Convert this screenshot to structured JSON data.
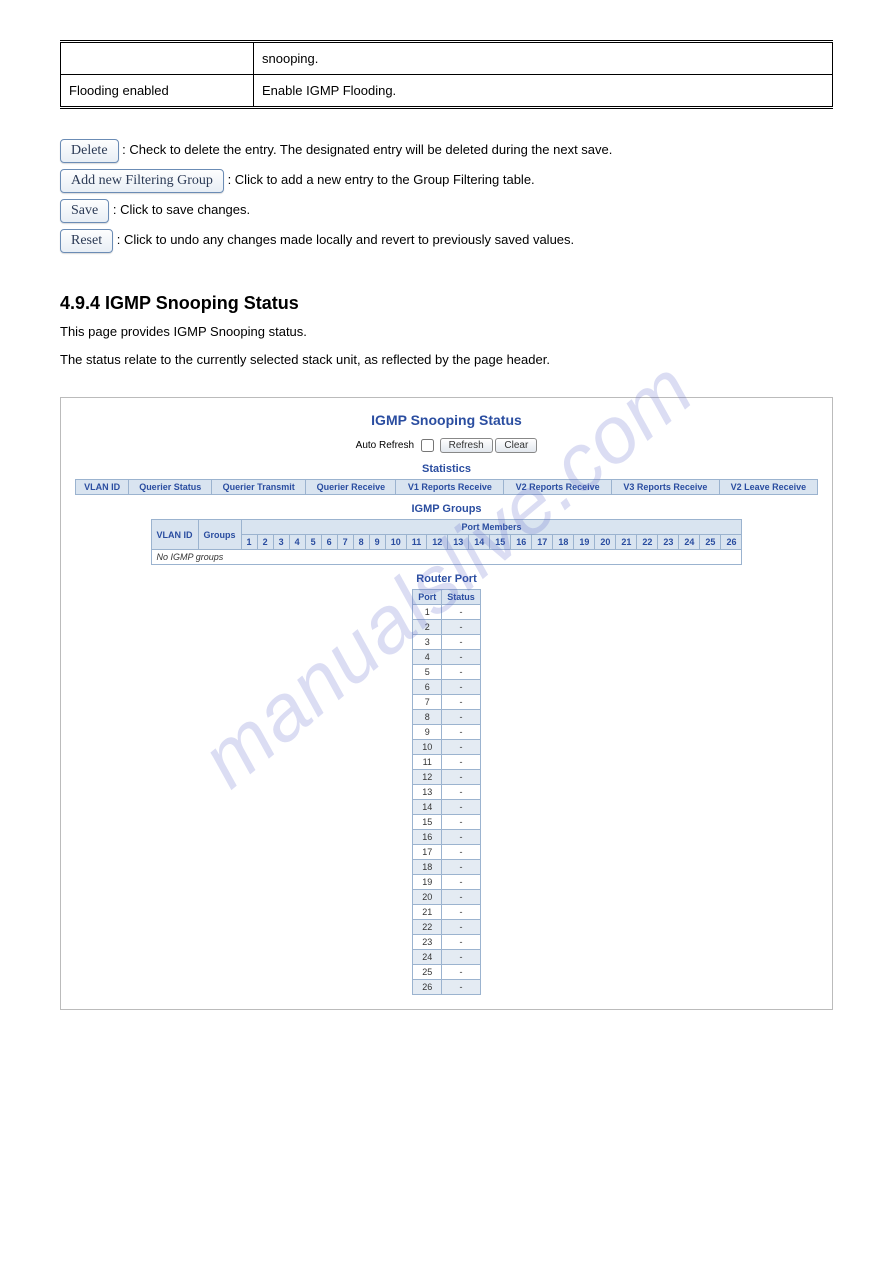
{
  "doc_table": {
    "row1_col1": "",
    "row1_col2": "snooping.",
    "row2_col1": "Flooding enabled",
    "row2_col2": "Enable IGMP Flooding."
  },
  "buttons": {
    "delete": "Delete",
    "delete_desc": ": Check to delete the entry. The designated entry will be deleted during the next save.",
    "add": "Add new Filtering Group",
    "add_desc": ": Click to add a new entry to the Group Filtering table.",
    "save": "Save",
    "save_desc": ": Click to save changes.",
    "reset": "Reset",
    "reset_desc": ": Click to undo any changes made locally and revert to previously saved values."
  },
  "heading": "4.9.4 IGMP Snooping Status",
  "body": "This page provides IGMP Snooping status.",
  "body2": "The status relate to the currently selected stack unit, as reflected by the page header.",
  "watermark": "manualslive.com",
  "screenshot": {
    "title": "IGMP Snooping Status",
    "auto_label": "Auto Refresh",
    "refresh": "Refresh",
    "clear": "Clear",
    "sub_stats": "Statistics",
    "stats_headers": [
      "VLAN ID",
      "Querier Status",
      "Querier Transmit",
      "Querier Receive",
      "V1 Reports Receive",
      "V2 Reports Receive",
      "V3 Reports Receive",
      "V2 Leave Receive"
    ],
    "sub_groups": "IGMP Groups",
    "groups_span": "Port Members",
    "groups_h1": "VLAN ID",
    "groups_h2": "Groups",
    "port_nums": [
      "1",
      "2",
      "3",
      "4",
      "5",
      "6",
      "7",
      "8",
      "9",
      "10",
      "11",
      "12",
      "13",
      "14",
      "15",
      "16",
      "17",
      "18",
      "19",
      "20",
      "21",
      "22",
      "23",
      "24",
      "25",
      "26"
    ],
    "no_groups": "No IGMP groups",
    "sub_router": "Router Port",
    "rp_h1": "Port",
    "rp_h2": "Status",
    "rp_rows": [
      "1",
      "2",
      "3",
      "4",
      "5",
      "6",
      "7",
      "8",
      "9",
      "10",
      "11",
      "12",
      "13",
      "14",
      "15",
      "16",
      "17",
      "18",
      "19",
      "20",
      "21",
      "22",
      "23",
      "24",
      "25",
      "26"
    ],
    "rp_status": "-"
  }
}
